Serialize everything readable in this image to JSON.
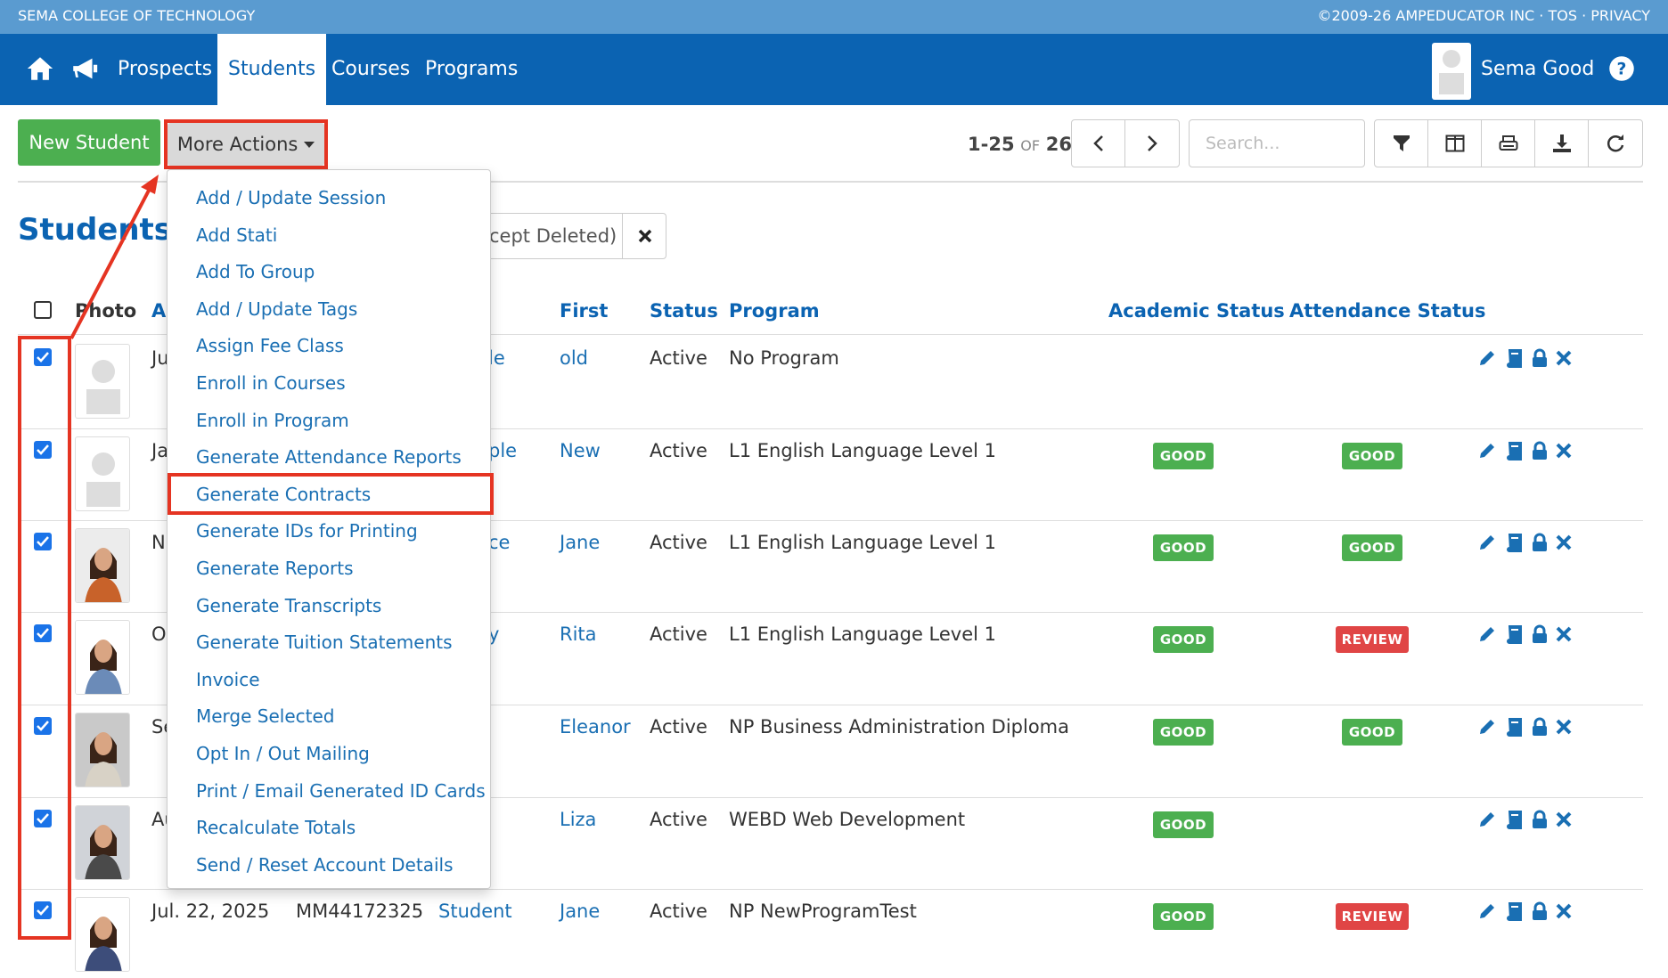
{
  "topbar": {
    "brand": "SEMA COLLEGE OF TECHNOLOGY",
    "legal": "©2009-26 AMPEDUCATOR INC  ·  TOS  ·  PRIVACY"
  },
  "nav": {
    "links": [
      "Prospects",
      "Students",
      "Courses",
      "Programs"
    ],
    "active": "Students",
    "user_name": "Sema Good"
  },
  "toolbar": {
    "new_student": "New Student",
    "more_actions": "More Actions",
    "pager_range": "1-25",
    "pager_of": "OF",
    "pager_total": "26",
    "search_placeholder": "Search..."
  },
  "page": {
    "title": "Students",
    "filter_chip": "cept Deleted)"
  },
  "table": {
    "headers": {
      "photo": "Photo",
      "added": "Ad",
      "first": "First",
      "status": "Status",
      "program": "Program",
      "academic": "Academic Status",
      "attendance": "Attendance Status"
    },
    "rows": [
      {
        "added": "Ju",
        "last": "le",
        "first": "old",
        "status": "Active",
        "program": "No Program",
        "academic": "",
        "attendance": ""
      },
      {
        "added": "Ja",
        "last": "ple",
        "first": "New",
        "status": "Active",
        "program": "L1 English Language Level 1",
        "academic": "GOOD",
        "attendance": "GOOD"
      },
      {
        "added": "N",
        "last": "ce",
        "first": "Jane",
        "status": "Active",
        "program": "L1 English Language Level 1",
        "academic": "GOOD",
        "attendance": "GOOD"
      },
      {
        "added": "O",
        "last": "y",
        "first": "Rita",
        "status": "Active",
        "program": "L1 English Language Level 1",
        "academic": "GOOD",
        "attendance": "REVIEW"
      },
      {
        "added": "Se",
        "last": "",
        "first": "Eleanor",
        "status": "Active",
        "program": "NP Business Administration Diploma",
        "academic": "GOOD",
        "attendance": "GOOD"
      },
      {
        "added": "Au",
        "last": "",
        "first": "Liza",
        "status": "Active",
        "program": "WEBD Web Development",
        "academic": "GOOD",
        "attendance": ""
      },
      {
        "added": "Jul. 22, 2025",
        "id": "MM44172325",
        "last": "Student",
        "first": "Jane",
        "status": "Active",
        "program": "NP NewProgramTest",
        "academic": "GOOD",
        "attendance": "REVIEW"
      }
    ]
  },
  "dropdown": {
    "items": [
      "Add / Update Session",
      "Add Stati",
      "Add To Group",
      "Add / Update Tags",
      "Assign Fee Class",
      "Enroll in Courses",
      "Enroll in Program",
      "Generate Attendance Reports",
      "Generate Contracts",
      "Generate IDs for Printing",
      "Generate Reports",
      "Generate Transcripts",
      "Generate Tuition Statements",
      "Invoice",
      "Merge Selected",
      "Opt In / Out Mailing",
      "Print / Email Generated ID Cards",
      "Recalculate Totals",
      "Send / Reset Account Details"
    ],
    "highlighted": "Generate Contracts"
  },
  "colors": {
    "brand_blue": "#0b63b2",
    "topbar_blue": "#5a9bd0",
    "green": "#4caf50",
    "red": "#e04545",
    "highlight": "#e53422"
  }
}
